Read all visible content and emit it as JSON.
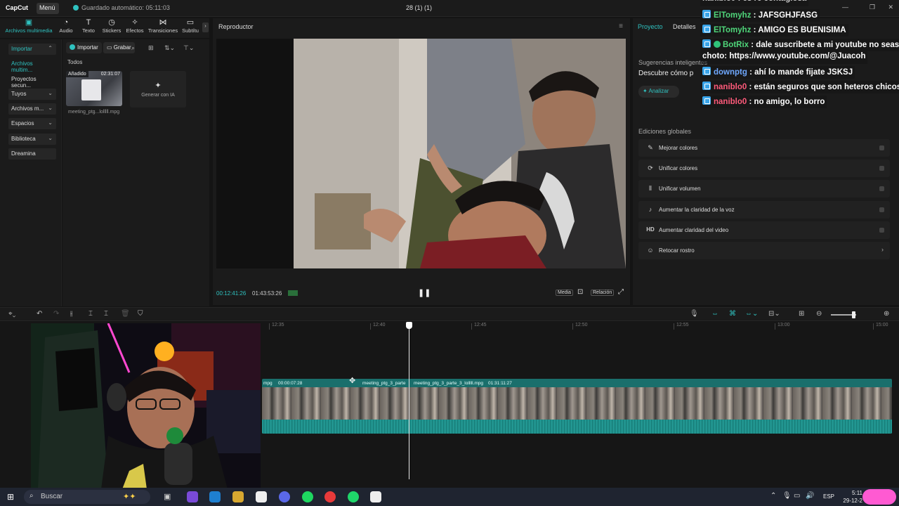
{
  "titlebar": {
    "logo": "CapCut",
    "menu": "Menú",
    "autosave": "Guardado automático: 05:11:03",
    "project_name": "28 (1) (1)"
  },
  "tooltabs": [
    {
      "label": "Archivos multimedia",
      "icon": "media-icon",
      "glyph": "▣",
      "active": true
    },
    {
      "label": "Audio",
      "icon": "audio-icon",
      "glyph": "◔"
    },
    {
      "label": "Texto",
      "icon": "text-icon",
      "glyph": "T"
    },
    {
      "label": "Stickers",
      "icon": "sticker-icon",
      "glyph": "◷"
    },
    {
      "label": "Efectos",
      "icon": "effects-icon",
      "glyph": "✧"
    },
    {
      "label": "Transiciones",
      "icon": "transition-icon",
      "glyph": "⋈"
    },
    {
      "label": "Subtítu",
      "icon": "subtitle-icon",
      "glyph": "▭"
    }
  ],
  "sidebar": {
    "importar": "Importar",
    "items": [
      {
        "label": "Archivos multim...",
        "accent": true
      },
      {
        "label": "Proyectos secun..."
      },
      {
        "label": "Tuyos",
        "boxed": true
      },
      {
        "label": "Archivos m...",
        "boxed": true
      },
      {
        "label": "Espacios",
        "boxed": true
      },
      {
        "label": "Biblioteca",
        "boxed": true
      },
      {
        "label": "Dreamina",
        "boxed": true
      }
    ]
  },
  "media": {
    "import_btn": "Importar",
    "record_btn": "Grabar",
    "section": "Todos",
    "thumb_badge": "Añadido",
    "thumb_duration": "02:31:07",
    "file_name": "meeting_ptg...lolllll.mpg",
    "generate_ai": "Generar con IA"
  },
  "player": {
    "title": "Reproductor",
    "time_current": "00:12:41:26",
    "time_total": "01:43:53:26",
    "btn_media": "Media",
    "btn_ratio": "Relación"
  },
  "right_panel": {
    "tab_project": "Proyecto",
    "tab_details": "Detalles",
    "smart_section": "Sugerencias inteligentes",
    "discover": "Descubre cómo p",
    "analyze_btn": "Analizar",
    "global_section": "Ediciones globales",
    "options": [
      {
        "label": "Mejorar colores",
        "icon": "enhance-color-icon",
        "glyph": "✎"
      },
      {
        "label": "Unificar colores",
        "icon": "unify-color-icon",
        "glyph": "⟳"
      },
      {
        "label": "Unificar volumen",
        "icon": "volume-icon",
        "glyph": "⦀"
      },
      {
        "label": "Aumentar la claridad de la voz",
        "icon": "voice-icon",
        "glyph": "♪"
      },
      {
        "label": "Aumentar claridad del video",
        "icon": "hd-icon",
        "glyph": "HD"
      },
      {
        "label": "Retocar rostro",
        "icon": "face-icon",
        "glyph": "☺"
      }
    ]
  },
  "chat": {
    "top_partial": "naniblo0 : es re contagiosa",
    "messages": [
      {
        "user": "ElTomyhz",
        "color": "#4fd67a",
        "text": ": JAFSGHJFASG"
      },
      {
        "user": "ElTomyhz",
        "color": "#4fd67a",
        "text": ": AMIGO ES BUENISIMA"
      },
      {
        "user": "BotRix",
        "color": "#4fd67a",
        "text": ": dale suscribete a mi youtube no seas",
        "verified": true
      },
      {
        "user": "",
        "color": "#ffffff",
        "text": "choto: https://www.youtube.com/@Juacoh",
        "continuation": true
      },
      {
        "user": "downptg",
        "color": "#6fa8ff",
        "text": ": ahí lo mande fijate JSKSJ"
      },
      {
        "user": "naniblo0",
        "color": "#ff5a7a",
        "text": ": están seguros que son heteros chicos?"
      },
      {
        "user": "naniblo0",
        "color": "#ff5a7a",
        "text": ": no amigo, lo borro"
      }
    ]
  },
  "timeline": {
    "ruler": [
      "12:35",
      "12:40",
      "12:45",
      "12:50",
      "12:55",
      "13:00",
      "15:00"
    ],
    "clip_labels": [
      "mpg",
      "00:00:07:28",
      "meeting_ptg_3_parte",
      "meeting_ptg_3_parte_3_lolllll.mpg",
      "01:31:11:27"
    ]
  },
  "taskbar": {
    "search": "Buscar",
    "lang": "ESP",
    "time": "5:11",
    "date": "29-12-2"
  }
}
